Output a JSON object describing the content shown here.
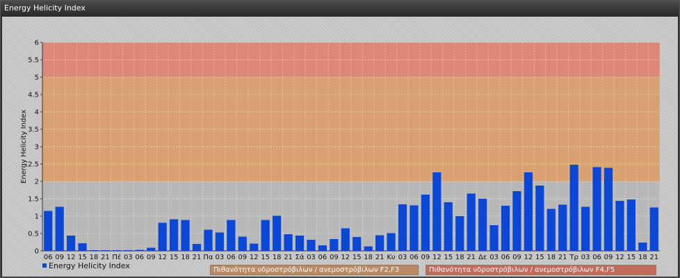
{
  "window": {
    "title": "Energy Helicity Index"
  },
  "chart_data": {
    "type": "bar",
    "ylabel": "Energy Helicity Index",
    "ylim": [
      0,
      6
    ],
    "yticks": [
      "0",
      "0.5",
      "1",
      "1.5",
      "2",
      "2.5",
      "3",
      "3.5",
      "4",
      "4.5",
      "5",
      "5.5",
      "6"
    ],
    "categories": [
      "06",
      "09",
      "12",
      "15",
      "18",
      "21",
      "Πέ",
      "03",
      "06",
      "09",
      "12",
      "15",
      "18",
      "21",
      "Πα",
      "03",
      "06",
      "09",
      "12",
      "15",
      "18",
      "21",
      "Σά",
      "03",
      "06",
      "09",
      "12",
      "15",
      "18",
      "21",
      "Κυ",
      "03",
      "06",
      "09",
      "12",
      "15",
      "18",
      "21",
      "Δε",
      "03",
      "06",
      "09",
      "12",
      "15",
      "18",
      "21",
      "Τρ",
      "03",
      "06",
      "09",
      "12",
      "15",
      "18",
      "21"
    ],
    "series": [
      {
        "name": "Energy Helicity Index",
        "color": "#0b47d6",
        "values": [
          1.15,
          1.27,
          0.44,
          0.22,
          0.02,
          0.02,
          0.02,
          0.02,
          0.03,
          0.09,
          0.81,
          0.91,
          0.89,
          0.2,
          0.61,
          0.53,
          0.89,
          0.41,
          0.21,
          0.89,
          1.01,
          0.48,
          0.44,
          0.32,
          0.16,
          0.34,
          0.65,
          0.4,
          0.13,
          0.45,
          0.51,
          1.34,
          1.31,
          1.62,
          2.26,
          1.4,
          1.0,
          1.65,
          1.5,
          0.74,
          1.3,
          1.72,
          2.26,
          1.88,
          1.21,
          1.33,
          2.48,
          1.27,
          2.41,
          2.39,
          1.44,
          1.48,
          0.24,
          1.25
        ]
      }
    ],
    "bands": [
      {
        "from": 2,
        "to": 5,
        "color": "#d9a06b",
        "label": "Πιθανότητα υδροστρόβιλων / ανεμοστρόβιλων F2,F3"
      },
      {
        "from": 5,
        "to": 6,
        "color": "#de8572",
        "label": "Πιθανότητα υδροστρόβιλων / ανεμοστρόβιλων F4,F5"
      }
    ],
    "grid": true,
    "legend": "bottom-left"
  }
}
